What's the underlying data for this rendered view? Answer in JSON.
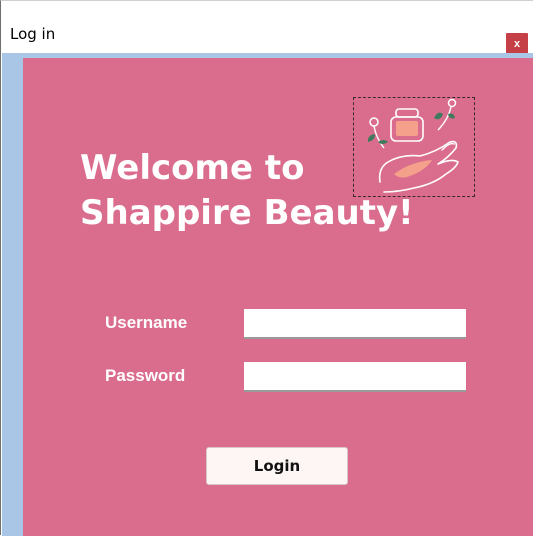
{
  "window": {
    "title": "Log in",
    "close_label": "x"
  },
  "welcome": {
    "line1": "Welcome to",
    "line2": "Shappire Beauty!"
  },
  "form": {
    "username_label": "Username",
    "username_value": "",
    "password_label": "Password",
    "password_value": "",
    "login_label": "Login"
  },
  "logo": {
    "icon": "cosmetics-hand-icon"
  },
  "colors": {
    "background": "#da6d8e",
    "frame_border": "#aac6e6",
    "close_button": "#c43f46",
    "text_on_background": "#ffffff",
    "button_background": "#fdf6f5"
  }
}
